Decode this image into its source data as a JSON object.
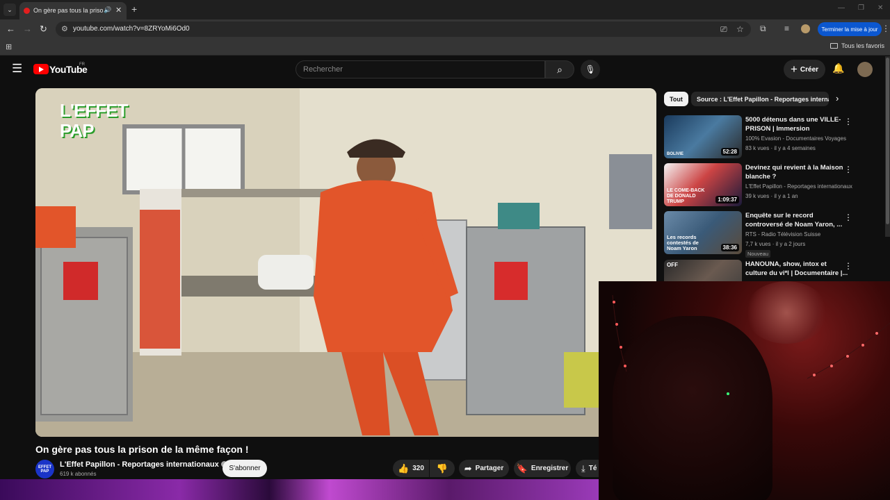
{
  "browser": {
    "tab_title": "On gère pas tous la prison",
    "url": "youtube.com/watch?v=8ZRYoMi6Od0",
    "update_label": "Terminer la mise à jour",
    "bookmarks_all": "Tous les favoris"
  },
  "header": {
    "wordmark": "YouTube",
    "country": "FR",
    "search_placeholder": "Rechercher",
    "create_label": "Créer"
  },
  "video": {
    "title": "On gère pas tous la prison de la même façon !",
    "channel": "L'Effet Papillon - Reportages internationaux",
    "channel_avatar_text": "EFFET PAP",
    "subs": "619 k abonnés",
    "subscribe_label": "S'abonner",
    "likes": "320",
    "share_label": "Partager",
    "save_label": "Enregistrer",
    "download_label": "Té",
    "watermark": "L'EFFET PAP"
  },
  "sidebar": {
    "chips": [
      "Tout",
      "Source : L'Effet Papillon - Reportages internationaux"
    ],
    "items": [
      {
        "title": "5000 détenus dans une VILLE-PRISON | Immersion",
        "channel": "100% Evasion - Documentaires Voyages",
        "meta": "83 k vues · il y a 4 semaines",
        "duration": "52:28",
        "thumb_text": "BOLIVIE",
        "badge": ""
      },
      {
        "title": "Devinez qui revient à la Maison blanche ?",
        "channel": "L'Effet Papillon - Reportages internationaux",
        "meta": "39 k vues · il y a 1 an",
        "duration": "1:09:37",
        "thumb_text": "LE COME-BACK DE DONALD TRUMP",
        "badge": ""
      },
      {
        "title": "Enquête sur le record controversé de Noam Yaron, ...",
        "channel": "RTS - Radio Télévision Suisse",
        "meta": "7,7 k vues · il y a 2 jours",
        "duration": "38:36",
        "thumb_text": "Les records contestés de Noam Yaron",
        "badge": "Nouveau"
      },
      {
        "title": "HANOUNA, show, intox et culture du vi*l | Documentaire |...",
        "channel": "",
        "meta": "",
        "duration": "",
        "thumb_text": "OFF",
        "badge": ""
      }
    ]
  },
  "colors": {
    "accent_red": "#ff0000",
    "update_blue": "#0b57d0",
    "prison_orange": "#e2552a"
  }
}
